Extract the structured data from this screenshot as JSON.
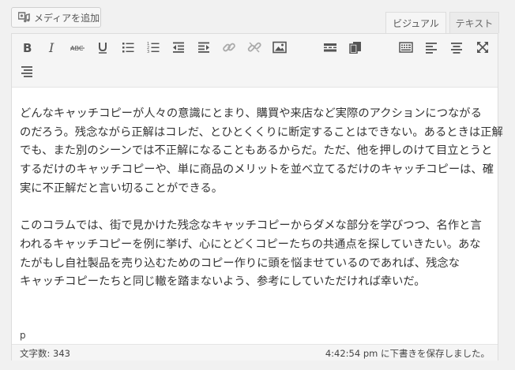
{
  "media_button": {
    "label": "メディアを追加"
  },
  "tabs": [
    {
      "label": "ビジュアル",
      "active": true
    },
    {
      "label": "テキスト",
      "active": false
    }
  ],
  "toolbar": {
    "icons": [
      "bold-icon",
      "italic-icon",
      "strikethrough-icon",
      "underline-icon",
      "bulleted-list-icon",
      "numbered-list-icon",
      "outdent-icon",
      "indent-icon",
      "insert-link-icon",
      "unlink-icon",
      "insert-image-icon",
      "read-more-icon",
      "paste-icon",
      "toolbar-toggle-icon",
      "align-left-icon",
      "align-center-icon",
      "fullscreen-icon",
      "align-justify-icon"
    ]
  },
  "content": {
    "paragraph1": [
      "どんなキャッチコピーが人々の意識にとまり、購買や来店など実際のアクションにつながる",
      "のだろう。残念ながら正解はコレだ、とひとくくりに断定することはできない。あるときは正解",
      "でも、また別のシーンでは不正解になることもあるからだ。ただ、他を押しのけて目立とうと",
      "するだけのキャッチコピーや、単に商品のメリットを並べ立てるだけのキャッチコピーは、確",
      "実に不正解だと言い切ることができる。"
    ],
    "paragraph2": [
      "このコラムでは、街で見かけた残念なキャッチコピーからダメな部分を学びつつ、名作と言",
      "われるキャッチコピーを例に挙げ、心にとどくコピーたちの共通点を探していきたい。あな",
      "たがもし自社製品を売り込むためのコピー作りに頭を悩ませているのであれば、残念な",
      "キャッチコピーたちと同じ轍を踏まないよう、参考にしていただければ幸いだ。"
    ]
  },
  "path": "p",
  "status": {
    "word_count": "文字数: 343",
    "saved": "4:42:54 pm に下書きを保存しました。"
  }
}
